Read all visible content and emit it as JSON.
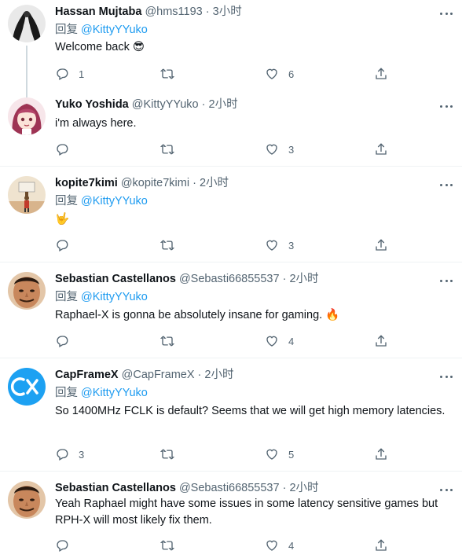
{
  "reply_label": "回复",
  "tweets": [
    {
      "display_name": "Hassan Mujtaba",
      "handle": "@hms1193",
      "time": "3小时",
      "reply_to": "@KittyYYuko",
      "text": "Welcome back 😎",
      "replies": "1",
      "retweets": "",
      "likes": "6",
      "avatar_color": "#1a1a1a"
    },
    {
      "display_name": "Yuko Yoshida",
      "handle": "@KittyYYuko",
      "time": "2小时",
      "reply_to": "",
      "text": "i'm always here.",
      "replies": "",
      "retweets": "",
      "likes": "3",
      "avatar_color": "#b5466a"
    },
    {
      "display_name": "kopite7kimi",
      "handle": "@kopite7kimi",
      "time": "2小时",
      "reply_to": "@KittyYYuko",
      "text": "🤟",
      "replies": "",
      "retweets": "",
      "likes": "3",
      "avatar_color": "#d8b48c"
    },
    {
      "display_name": "Sebastian Castellanos",
      "handle": "@Sebasti66855537",
      "time": "2小时",
      "reply_to": "@KittyYYuko",
      "text": "Raphael-X is gonna be absolutely insane for gaming. 🔥",
      "replies": "",
      "retweets": "",
      "likes": "4",
      "avatar_color": "#c8875c"
    },
    {
      "display_name": "CapFrameX",
      "handle": "@CapFrameX",
      "time": "2小时",
      "reply_to": "@KittyYYuko",
      "text": "So 1400MHz FCLK is default? Seems that we will get high memory latencies.",
      "replies": "3",
      "retweets": "",
      "likes": "5",
      "avatar_color": "#1da1f2"
    },
    {
      "display_name": "Sebastian Castellanos",
      "handle": "@Sebasti66855537",
      "time": "2小时",
      "reply_to": "",
      "text": "Yeah Raphael might have some issues in some latency sensitive games but RPH-X will most likely fix them.",
      "replies": "",
      "retweets": "",
      "likes": "4",
      "avatar_color": "#c8875c"
    }
  ]
}
